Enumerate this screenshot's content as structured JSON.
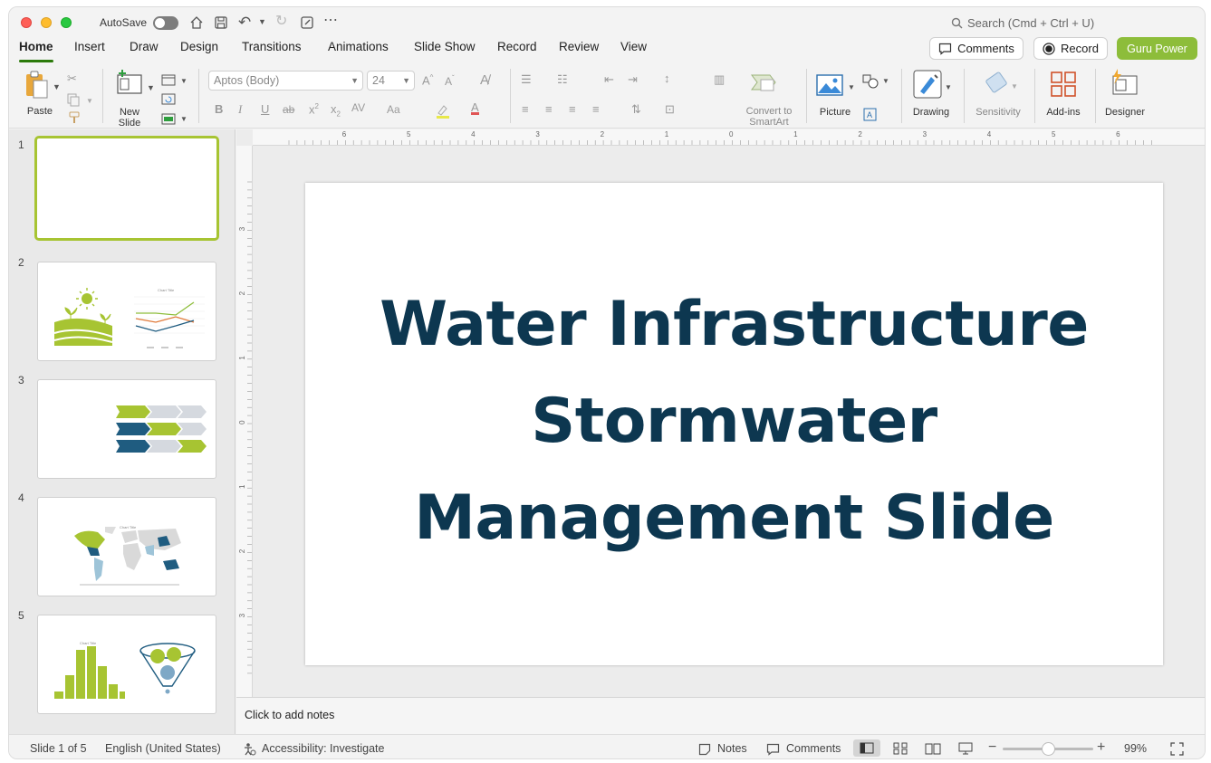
{
  "titlebar": {
    "autosave_label": "AutoSave",
    "search_placeholder": "Search (Cmd + Ctrl + U)"
  },
  "tabs": [
    "Home",
    "Insert",
    "Draw",
    "Design",
    "Transitions",
    "Animations",
    "Slide Show",
    "Record",
    "Review",
    "View"
  ],
  "header_buttons": {
    "comments": "Comments",
    "record": "Record",
    "guru": "Guru Power"
  },
  "ribbon": {
    "paste": "Paste",
    "new_slide_1": "New",
    "new_slide_2": "Slide",
    "font_name": "Aptos (Body)",
    "font_size": "24",
    "convert_1": "Convert to",
    "convert_2": "SmartArt",
    "picture": "Picture",
    "drawing": "Drawing",
    "sensitivity": "Sensitivity",
    "addins": "Add-ins",
    "designer": "Designer"
  },
  "thumbnails": {
    "numbers": [
      "1",
      "2",
      "3",
      "4",
      "5"
    ],
    "chart_title": "Chart Title"
  },
  "ruler": {
    "h_labels": [
      "6",
      "5",
      "4",
      "3",
      "2",
      "1",
      "0",
      "1",
      "2",
      "3",
      "4",
      "5",
      "6"
    ],
    "v_labels": [
      "3",
      "2",
      "1",
      "0",
      "1",
      "2",
      "3"
    ]
  },
  "slide": {
    "title_lines": [
      "Water Infrastructure",
      "Stormwater",
      "Management Slide"
    ]
  },
  "notes_placeholder": "Click to add notes",
  "status": {
    "slide_pos": "Slide 1 of 5",
    "language": "English (United States)",
    "accessibility": "Accessibility: Investigate",
    "notes": "Notes",
    "comments": "Comments",
    "zoom": "99%",
    "zoom_level": 0.5
  },
  "colors": {
    "accent_green": "#a7c432",
    "ribbon_green": "#8dbd3a",
    "title_navy": "#0d3750",
    "blue": "#1f5c80"
  }
}
